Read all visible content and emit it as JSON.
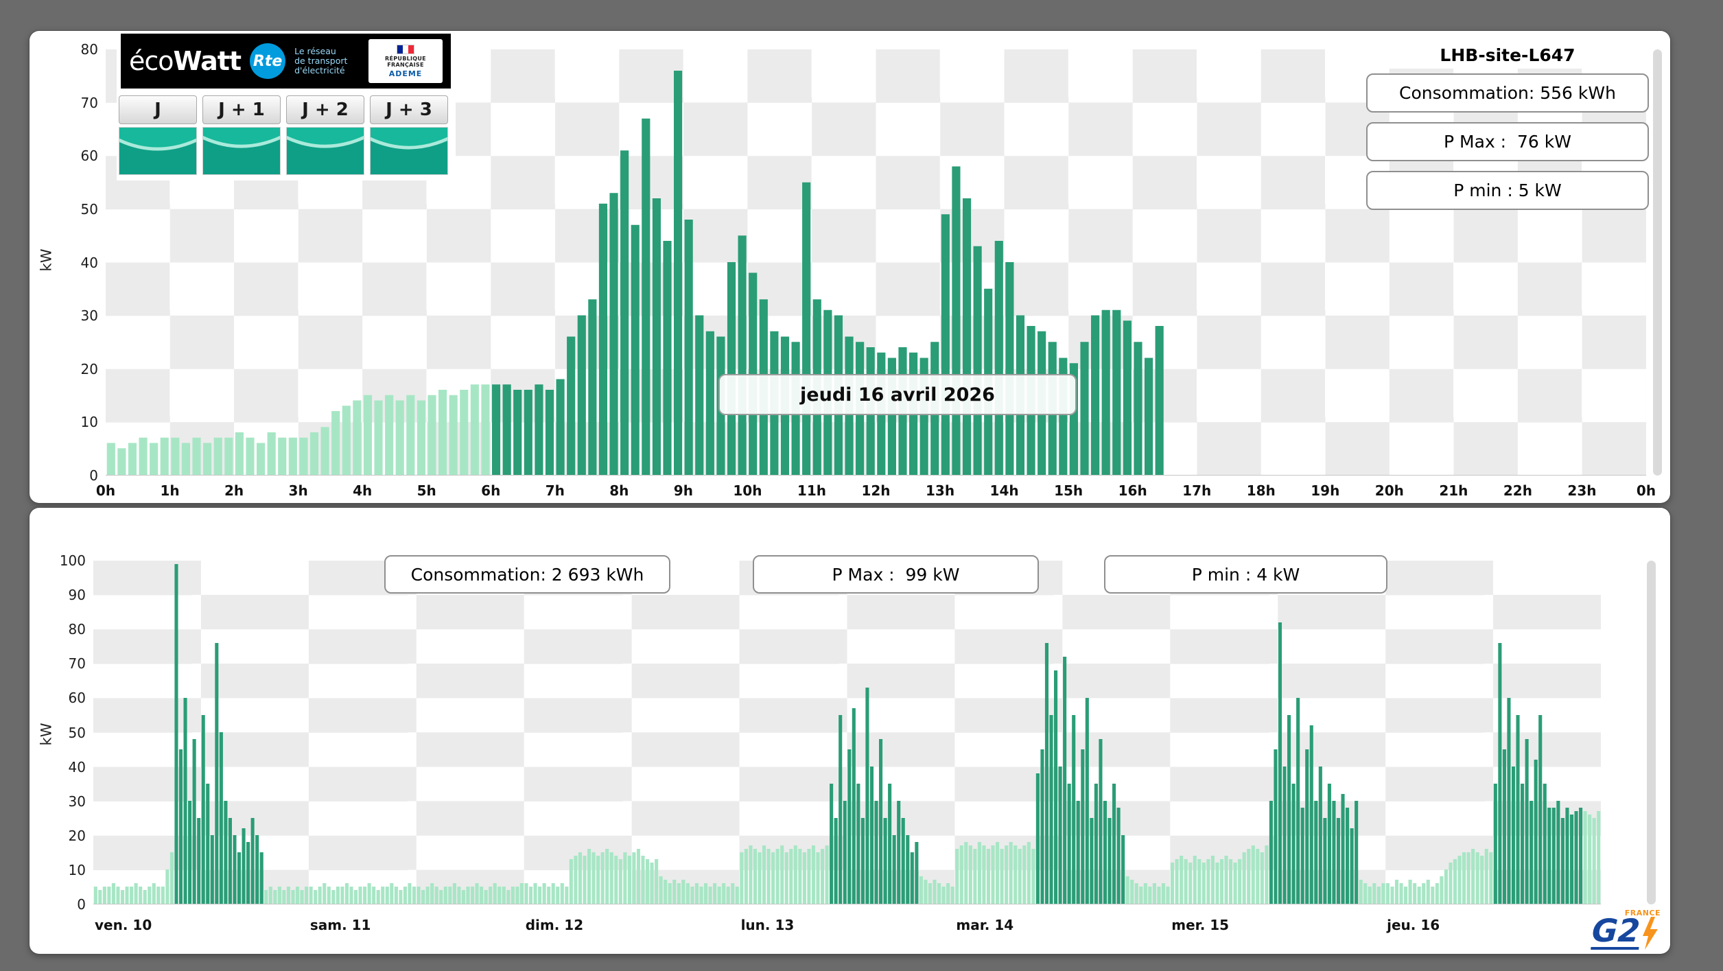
{
  "page": {
    "background": "#6b6b6b"
  },
  "top_panel": {
    "site_title": "LHB-site-L647",
    "ylabel": "kW",
    "date_label": "jeudi 16 avril 2026",
    "stats": [
      {
        "label": "Consommation: 556 kWh"
      },
      {
        "label": "P Max :  76 kW"
      },
      {
        "label": "P min : 5 kW"
      }
    ],
    "ecowatt": {
      "brand_light": "éco",
      "brand_bold": "Watt",
      "rte_abbr": "Rte",
      "rte_lines": [
        "Le réseau",
        "de transport",
        "d'électricité"
      ],
      "republique": [
        "RÉPUBLIQUE",
        "FRANÇAISE"
      ],
      "ademe": "ADEME",
      "tabs": [
        {
          "label": "J"
        },
        {
          "label": "J + 1"
        },
        {
          "label": "J + 2"
        },
        {
          "label": "J + 3"
        }
      ]
    }
  },
  "bottom_panel": {
    "ylabel": "kW",
    "stats": [
      {
        "label": "Consommation: 2 693 kWh"
      },
      {
        "label": "P Max :  99 kW"
      },
      {
        "label": "P min : 4 kW"
      }
    ],
    "g2e": {
      "text": "G2",
      "france": "FRANCE"
    }
  },
  "chart_data": [
    {
      "type": "bar",
      "ylabel": "kW",
      "ylim": [
        0,
        80
      ],
      "ytick_step": 10,
      "y_tick_labels": [
        "0",
        "10",
        "20",
        "30",
        "40",
        "50",
        "60",
        "70",
        "80"
      ],
      "x_tick_labels": [
        "0h",
        "1h",
        "2h",
        "3h",
        "4h",
        "5h",
        "6h",
        "7h",
        "8h",
        "9h",
        "10h",
        "11h",
        "12h",
        "13h",
        "14h",
        "15h",
        "16h",
        "17h",
        "18h",
        "19h",
        "20h",
        "21h",
        "22h",
        "23h",
        "0h"
      ],
      "x_tick_mode": "center",
      "interval_minutes": 10,
      "slots_per_axis": 144,
      "dark_from_index": 36,
      "color_light": "#a7e6c5",
      "color_dark": "#2a9d76",
      "annotation": "jeudi 16 avril 2026",
      "values": [
        6,
        5,
        6,
        7,
        6,
        7,
        7,
        6,
        7,
        6,
        7,
        7,
        8,
        7,
        6,
        8,
        7,
        7,
        7,
        8,
        9,
        12,
        13,
        14,
        15,
        14,
        15,
        14,
        15,
        14,
        15,
        16,
        15,
        16,
        17,
        17,
        17,
        17,
        16,
        16,
        17,
        16,
        18,
        26,
        30,
        33,
        51,
        53,
        61,
        47,
        67,
        52,
        44,
        76,
        48,
        30,
        27,
        26,
        40,
        45,
        38,
        33,
        27,
        26,
        25,
        55,
        33,
        31,
        30,
        26,
        25,
        24,
        23,
        22,
        24,
        23,
        22,
        25,
        49,
        58,
        52,
        43,
        35,
        44,
        40,
        30,
        28,
        27,
        25,
        22,
        21,
        25,
        30,
        31,
        31,
        29,
        25,
        22,
        28
      ]
    },
    {
      "type": "bar",
      "ylabel": "kW",
      "ylim": [
        0,
        100
      ],
      "ytick_step": 10,
      "y_tick_labels": [
        "0",
        "10",
        "20",
        "30",
        "40",
        "50",
        "60",
        "70",
        "80",
        "90",
        "100"
      ],
      "x_tick_labels": [
        "ven. 10",
        "sam. 11",
        "dim. 12",
        "lun. 13",
        "mar. 14",
        "mer. 15",
        "jeu. 16"
      ],
      "x_tick_mode": "edge",
      "interval_minutes": 30,
      "slots_per_axis": 336,
      "dark_ranges": [
        [
          18,
          37
        ],
        [
          164,
          183
        ],
        [
          210,
          229
        ],
        [
          262,
          281
        ],
        [
          312,
          331
        ]
      ],
      "color_light": "#a7e6c5",
      "color_dark": "#2a9d76",
      "values": [
        5,
        4,
        5,
        5,
        6,
        5,
        4,
        5,
        5,
        6,
        5,
        4,
        5,
        6,
        5,
        5,
        10,
        15,
        99,
        45,
        60,
        30,
        48,
        25,
        55,
        35,
        20,
        76,
        50,
        30,
        25,
        20,
        15,
        22,
        18,
        25,
        20,
        15,
        4,
        5,
        4,
        5,
        4,
        5,
        4,
        5,
        4,
        5,
        5,
        4,
        5,
        6,
        5,
        4,
        5,
        5,
        6,
        5,
        4,
        5,
        5,
        6,
        5,
        4,
        5,
        5,
        6,
        5,
        4,
        5,
        6,
        5,
        5,
        4,
        5,
        6,
        5,
        4,
        5,
        5,
        6,
        5,
        4,
        5,
        5,
        6,
        5,
        4,
        5,
        6,
        5,
        5,
        4,
        5,
        5,
        6,
        6,
        5,
        6,
        5,
        6,
        5,
        6,
        5,
        6,
        5,
        13,
        14,
        15,
        14,
        16,
        15,
        14,
        15,
        16,
        15,
        14,
        13,
        15,
        14,
        15,
        16,
        14,
        13,
        12,
        13,
        8,
        7,
        6,
        7,
        6,
        7,
        6,
        5,
        6,
        5,
        6,
        5,
        6,
        5,
        6,
        5,
        6,
        5,
        15,
        16,
        17,
        16,
        15,
        17,
        16,
        15,
        16,
        17,
        15,
        16,
        17,
        16,
        15,
        16,
        17,
        15,
        16,
        17,
        35,
        25,
        55,
        30,
        45,
        57,
        35,
        25,
        63,
        40,
        30,
        48,
        25,
        35,
        20,
        30,
        25,
        20,
        15,
        18,
        8,
        7,
        6,
        7,
        6,
        5,
        6,
        5,
        16,
        17,
        18,
        17,
        16,
        18,
        17,
        16,
        17,
        18,
        16,
        17,
        18,
        17,
        16,
        17,
        18,
        16,
        38,
        45,
        76,
        55,
        68,
        40,
        72,
        35,
        55,
        30,
        45,
        60,
        25,
        35,
        48,
        30,
        25,
        35,
        28,
        20,
        8,
        7,
        6,
        5,
        6,
        5,
        6,
        5,
        6,
        5,
        12,
        13,
        14,
        13,
        12,
        14,
        13,
        12,
        13,
        14,
        12,
        13,
        14,
        13,
        12,
        13,
        15,
        16,
        17,
        16,
        15,
        17,
        30,
        45,
        82,
        40,
        55,
        35,
        60,
        28,
        45,
        52,
        30,
        40,
        25,
        35,
        30,
        25,
        32,
        28,
        22,
        30,
        7,
        6,
        5,
        6,
        5,
        6,
        6,
        5,
        7,
        6,
        5,
        7,
        6,
        5,
        6,
        7,
        5,
        6,
        8,
        10,
        12,
        13,
        14,
        15,
        15,
        16,
        15,
        14,
        16,
        15,
        35,
        76,
        45,
        60,
        40,
        55,
        35,
        48,
        30,
        42,
        55,
        35,
        28,
        28,
        30,
        25,
        28,
        26,
        27,
        28,
        27,
        26,
        25,
        27
      ]
    }
  ]
}
